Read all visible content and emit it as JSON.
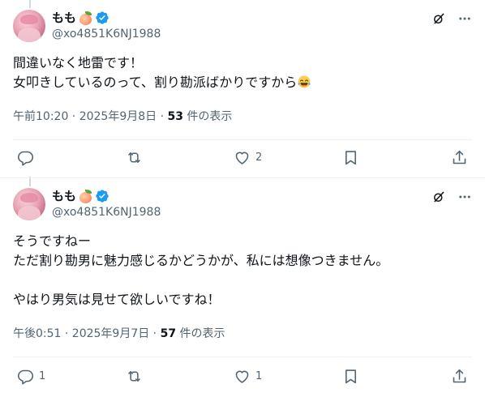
{
  "tweets": [
    {
      "author": {
        "name": "もも",
        "handle": "@xo4851K6NJ1988",
        "verified": true
      },
      "text_lines": [
        "間違いなく地雷です！",
        "女叩きしているのって、割り勘派ばかりですから"
      ],
      "timestamp": "午前10:20 · 2025年9月8日 · ",
      "views_count": "53",
      "views_label": " 件の表示",
      "actions": {
        "reply_count": "",
        "retweet_count": "",
        "like_count": "2"
      }
    },
    {
      "author": {
        "name": "もも",
        "handle": "@xo4851K6NJ1988",
        "verified": true
      },
      "text_lines": [
        "そうですねー",
        "ただ割り勘男に魅力感じるかどうかが、私には想像つきません。",
        "",
        "やはり男気は見せて欲しいですね！"
      ],
      "timestamp": "午後0:51 · 2025年9月7日 · ",
      "views_count": "57",
      "views_label": " 件の表示",
      "actions": {
        "reply_count": "1",
        "retweet_count": "",
        "like_count": "1"
      }
    }
  ],
  "colors": {
    "verified": "#1d9bf0",
    "muted": "#536471",
    "text": "#0f1419",
    "thread_line": "#cfd9de"
  }
}
